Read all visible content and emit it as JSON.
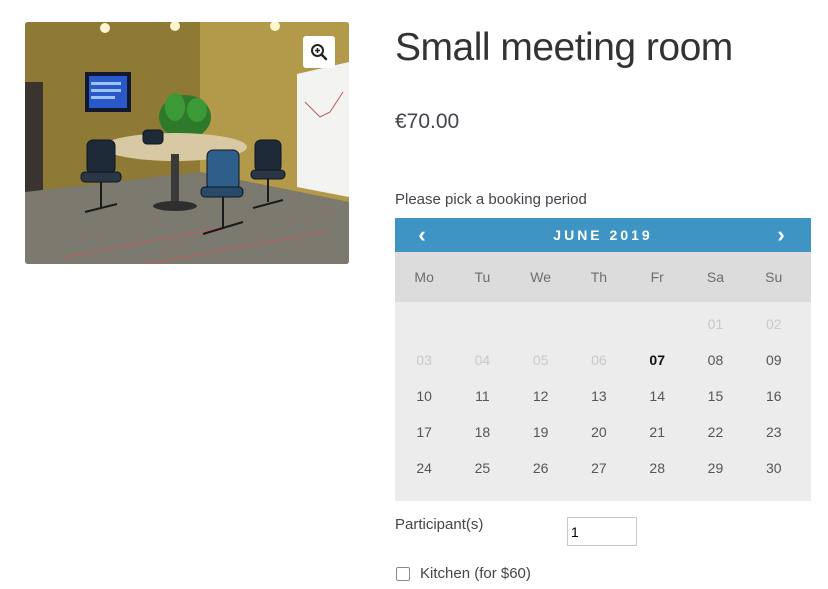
{
  "product": {
    "title": "Small meeting room",
    "price": "€70.00",
    "image_alt": "meeting-room-photo"
  },
  "booking": {
    "label": "Please pick a booking period",
    "calendar": {
      "month_label": "JUNE 2019",
      "prev_icon": "chevron-left-icon",
      "next_icon": "chevron-right-icon",
      "prev_glyph": "‹",
      "next_glyph": "›",
      "header_color": "#3e95c4",
      "weekdays": [
        "Mo",
        "Tu",
        "We",
        "Th",
        "Fr",
        "Sa",
        "Su"
      ],
      "weeks": [
        [
          "",
          "",
          "",
          "",
          "",
          "01",
          "02"
        ],
        [
          "03",
          "04",
          "05",
          "06",
          "07",
          "08",
          "09"
        ],
        [
          "10",
          "11",
          "12",
          "13",
          "14",
          "15",
          "16"
        ],
        [
          "17",
          "18",
          "19",
          "20",
          "21",
          "22",
          "23"
        ],
        [
          "24",
          "25",
          "26",
          "27",
          "28",
          "29",
          "30"
        ]
      ],
      "disabled_days": [
        "01",
        "02",
        "03",
        "04",
        "05",
        "06"
      ],
      "today": "07"
    }
  },
  "form": {
    "participants_label": "Participant(s)",
    "participants_value": "1",
    "kitchen_label": "Kitchen (for $60)",
    "kitchen_checked": false
  }
}
